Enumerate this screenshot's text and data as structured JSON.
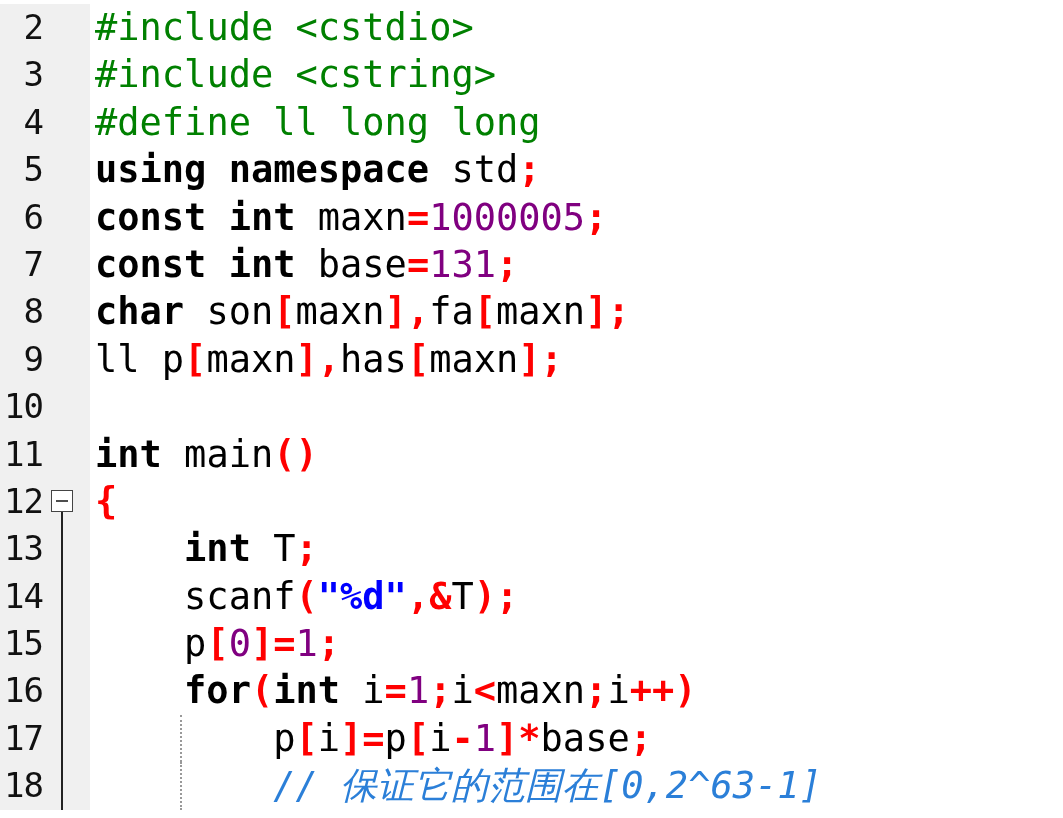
{
  "lines": [
    {
      "number": "2",
      "tokens": [
        {
          "kind": "pre",
          "text": "#include <cstdio>"
        }
      ]
    },
    {
      "number": "3",
      "tokens": [
        {
          "kind": "pre",
          "text": "#include <cstring>"
        }
      ]
    },
    {
      "number": "4",
      "tokens": [
        {
          "kind": "pre",
          "text": "#define ll long long"
        }
      ]
    },
    {
      "number": "5",
      "tokens": [
        {
          "kind": "kw",
          "text": "using namespace "
        },
        {
          "kind": "id",
          "text": "std"
        },
        {
          "kind": "op",
          "text": ";"
        }
      ]
    },
    {
      "number": "6",
      "tokens": [
        {
          "kind": "kw",
          "text": "const int "
        },
        {
          "kind": "id",
          "text": "maxn"
        },
        {
          "kind": "op",
          "text": "="
        },
        {
          "kind": "num",
          "text": "1000005"
        },
        {
          "kind": "op",
          "text": ";"
        }
      ]
    },
    {
      "number": "7",
      "tokens": [
        {
          "kind": "kw",
          "text": "const int "
        },
        {
          "kind": "id",
          "text": "base"
        },
        {
          "kind": "op",
          "text": "="
        },
        {
          "kind": "num",
          "text": "131"
        },
        {
          "kind": "op",
          "text": ";"
        }
      ]
    },
    {
      "number": "8",
      "tokens": [
        {
          "kind": "kw",
          "text": "char "
        },
        {
          "kind": "id",
          "text": "son"
        },
        {
          "kind": "op",
          "text": "["
        },
        {
          "kind": "id",
          "text": "maxn"
        },
        {
          "kind": "op",
          "text": "],"
        },
        {
          "kind": "id",
          "text": "fa"
        },
        {
          "kind": "op",
          "text": "["
        },
        {
          "kind": "id",
          "text": "maxn"
        },
        {
          "kind": "op",
          "text": "];"
        }
      ]
    },
    {
      "number": "9",
      "tokens": [
        {
          "kind": "id",
          "text": "ll p"
        },
        {
          "kind": "op",
          "text": "["
        },
        {
          "kind": "id",
          "text": "maxn"
        },
        {
          "kind": "op",
          "text": "],"
        },
        {
          "kind": "id",
          "text": "has"
        },
        {
          "kind": "op",
          "text": "["
        },
        {
          "kind": "id",
          "text": "maxn"
        },
        {
          "kind": "op",
          "text": "];"
        }
      ]
    },
    {
      "number": "10"
    },
    {
      "number": "11",
      "tokens": [
        {
          "kind": "kw",
          "text": "int "
        },
        {
          "kind": "id",
          "text": "main"
        },
        {
          "kind": "op",
          "text": "()"
        }
      ]
    },
    {
      "number": "12",
      "expanded": true,
      "tokens": [
        {
          "kind": "op",
          "text": "{"
        }
      ],
      "children": [
        {
          "number": "13",
          "tokens": [
            {
              "kind": "kw",
              "text": "int "
            },
            {
              "kind": "id",
              "text": "T"
            },
            {
              "kind": "op",
              "text": ";"
            }
          ]
        },
        {
          "number": "14",
          "tokens": [
            {
              "kind": "id",
              "text": "scanf"
            },
            {
              "kind": "op",
              "text": "("
            },
            {
              "kind": "str",
              "text": "\"%d\""
            },
            {
              "kind": "op",
              "text": ",&"
            },
            {
              "kind": "id",
              "text": "T"
            },
            {
              "kind": "op",
              "text": ");"
            }
          ]
        },
        {
          "number": "15",
          "tokens": [
            {
              "kind": "id",
              "text": "p"
            },
            {
              "kind": "op",
              "text": "["
            },
            {
              "kind": "num",
              "text": "0"
            },
            {
              "kind": "op",
              "text": "]="
            },
            {
              "kind": "num",
              "text": "1"
            },
            {
              "kind": "op",
              "text": ";"
            }
          ]
        },
        {
          "number": "16",
          "tokens": [
            {
              "kind": "kw",
              "text": "for"
            },
            {
              "kind": "op",
              "text": "("
            },
            {
              "kind": "kw",
              "text": "int "
            },
            {
              "kind": "id",
              "text": "i"
            },
            {
              "kind": "op",
              "text": "="
            },
            {
              "kind": "num",
              "text": "1"
            },
            {
              "kind": "op",
              "text": ";"
            },
            {
              "kind": "id",
              "text": "i"
            },
            {
              "kind": "op",
              "text": "<"
            },
            {
              "kind": "id",
              "text": "maxn"
            },
            {
              "kind": "op",
              "text": ";"
            },
            {
              "kind": "id",
              "text": "i"
            },
            {
              "kind": "op",
              "text": "++)"
            }
          ],
          "children": [
            {
              "number": "17",
              "tokens": [
                {
                  "kind": "id",
                  "text": "p"
                },
                {
                  "kind": "op",
                  "text": "["
                },
                {
                  "kind": "id",
                  "text": "i"
                },
                {
                  "kind": "op",
                  "text": "]="
                },
                {
                  "kind": "id",
                  "text": "p"
                },
                {
                  "kind": "op",
                  "text": "["
                },
                {
                  "kind": "id",
                  "text": "i"
                },
                {
                  "kind": "op",
                  "text": "-"
                },
                {
                  "kind": "num",
                  "text": "1"
                },
                {
                  "kind": "op",
                  "text": "]*"
                },
                {
                  "kind": "id",
                  "text": "base"
                },
                {
                  "kind": "op",
                  "text": ";"
                }
              ]
            },
            {
              "number": "18",
              "tokens": [
                {
                  "kind": "cmt",
                  "text": "// 保证它的范围在[0,2^63-1]"
                }
              ]
            }
          ]
        }
      ]
    }
  ]
}
